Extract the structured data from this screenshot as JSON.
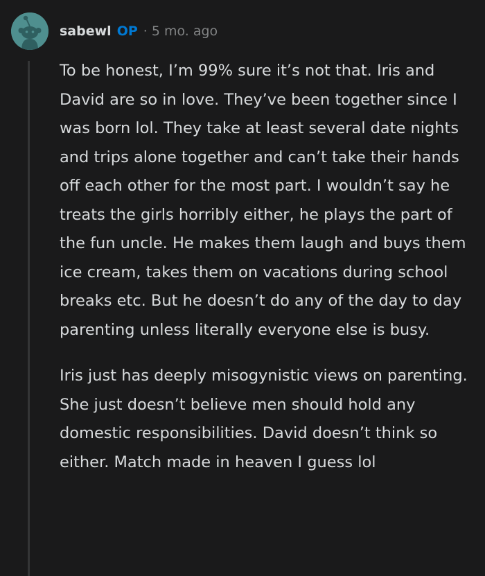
{
  "comment": {
    "author": "sabewl",
    "op_badge": "OP",
    "separator": "·",
    "timestamp": "5 mo. ago",
    "avatar_icon": "reddit-snoo-avatar-icon",
    "avatar_color": "#4f8f8f",
    "paragraphs": [
      "To be honest, I’m 99% sure it’s not that. Iris and David are so in love. They’ve been together since I was born lol. They take at least several date nights and trips alone together and can’t take their hands off each other for the most part. I wouldn’t say he treats the girls horribly either, he plays the part of the fun uncle. He makes them laugh and buys them ice cream, takes them on vacations during school breaks etc. But he doesn’t do any of the day to day parenting unless literally everyone else is busy.",
      "Iris just has deeply misogynistic views on parenting. She just doesn’t believe men should hold any domestic responsibilities. David doesn’t think so either. Match made in heaven I guess lol"
    ]
  },
  "colors": {
    "background": "#1a1a1b",
    "text": "#d7dadc",
    "meta": "#818384",
    "op_accent": "#0079d3",
    "thread_line": "#343536"
  }
}
